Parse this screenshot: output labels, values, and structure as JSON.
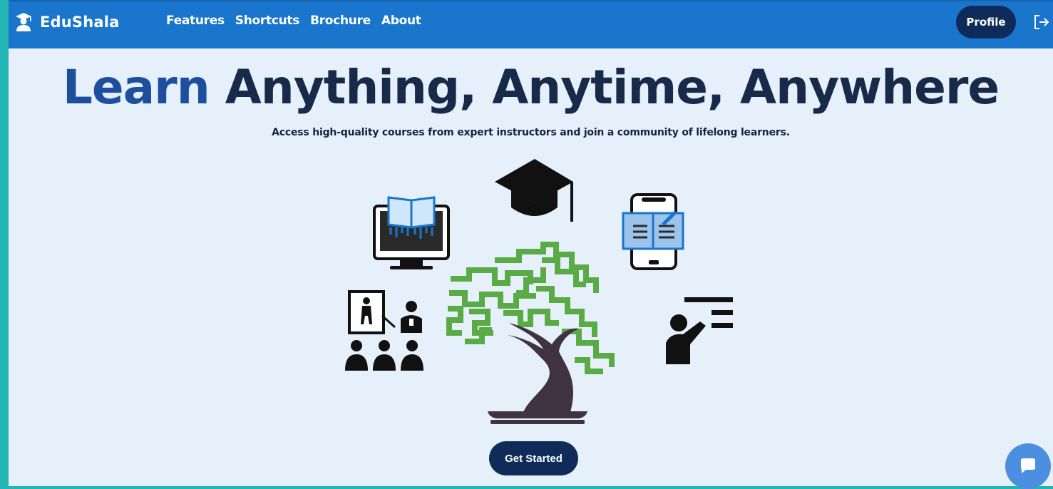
{
  "app": {
    "name": "EduShala",
    "logo_icon": "graduate-student-icon"
  },
  "nav": {
    "items": [
      "Features",
      "Shortcuts",
      "Brochure",
      "About"
    ]
  },
  "header": {
    "profile_label": "Profile",
    "logout_icon": "logout-icon"
  },
  "hero": {
    "title_accent": "Learn",
    "title_rest": "Anything, Anytime, Anywhere",
    "subtitle": "Access high-quality courses from expert instructors and join a community of lifelong learners.",
    "illustration_icons": [
      "monitor-book-icon",
      "graduation-cap-icon",
      "mobile-book-icon",
      "classroom-presentation-icon",
      "bonsai-tree-icon",
      "teacher-board-icon"
    ]
  },
  "cta": {
    "label": "Get Started"
  },
  "chat": {
    "icon": "chat-icon"
  },
  "colors": {
    "brand_bar": "#1a75cc",
    "dark_navy": "#0f2b5a",
    "page_bg": "#e6f0fb",
    "accent_title": "#1d4f9c",
    "tree_green": "#5aaa46"
  }
}
